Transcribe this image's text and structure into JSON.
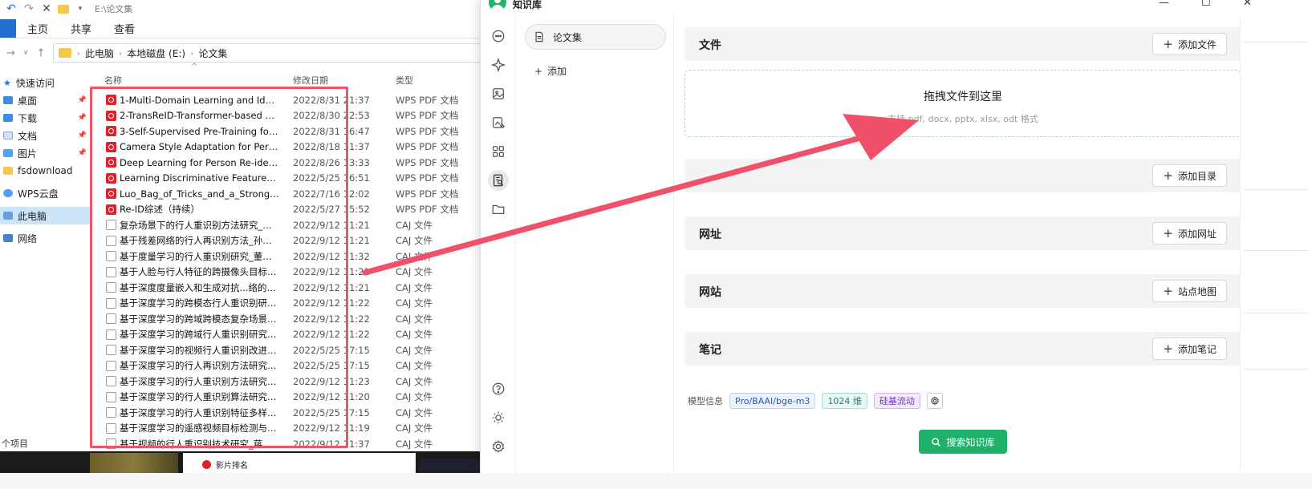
{
  "explorer": {
    "title_path": "E:\\论文集",
    "ribbon_tabs": [
      "主页",
      "共享",
      "查看"
    ],
    "breadcrumb": [
      "此电脑",
      "本地磁盘 (E:)",
      "论文集"
    ],
    "columns": {
      "name": "名称",
      "date": "修改日期",
      "type": "类型"
    },
    "nav": [
      {
        "label": "快速访问",
        "icon": "star-icon",
        "pinned": false,
        "selected": false
      },
      {
        "label": "桌面",
        "icon": "desktop-icon",
        "pinned": true,
        "selected": false
      },
      {
        "label": "下载",
        "icon": "download-icon",
        "pinned": true,
        "selected": false
      },
      {
        "label": "文档",
        "icon": "document-icon",
        "pinned": true,
        "selected": false
      },
      {
        "label": "图片",
        "icon": "picture-icon",
        "pinned": true,
        "selected": false
      },
      {
        "label": "fsdownload",
        "icon": "folder-icon",
        "pinned": false,
        "selected": false
      },
      {
        "label": "WPS云盘",
        "icon": "cloud-icon",
        "pinned": false,
        "selected": false
      },
      {
        "label": "此电脑",
        "icon": "computer-icon",
        "pinned": false,
        "selected": true
      },
      {
        "label": "网络",
        "icon": "network-icon",
        "pinned": false,
        "selected": false
      }
    ],
    "files": [
      {
        "name": "1-Multi-Domain Learning and Identit...",
        "date": "2022/8/31 21:37",
        "type": "WPS PDF 文档",
        "kind": "pdf"
      },
      {
        "name": "2-TransReID-Transformer-based Obj...",
        "date": "2022/8/30 22:53",
        "type": "WPS PDF 文档",
        "kind": "pdf"
      },
      {
        "name": "3-Self-Supervised Pre-Training for Tr...",
        "date": "2022/8/31 16:47",
        "type": "WPS PDF 文档",
        "kind": "pdf"
      },
      {
        "name": "Camera Style Adaptation for Person ...",
        "date": "2022/8/18 11:37",
        "type": "WPS PDF 文档",
        "kind": "pdf"
      },
      {
        "name": "Deep Learning for Person Re-identifi...",
        "date": "2022/8/26 13:33",
        "type": "WPS PDF 文档",
        "kind": "pdf"
      },
      {
        "name": "Learning Discriminative Features with...",
        "date": "2022/5/25 16:51",
        "type": "WPS PDF 文档",
        "kind": "pdf"
      },
      {
        "name": "Luo_Bag_of_Tricks_and_a_Strong_Bas...",
        "date": "2022/7/16 12:02",
        "type": "WPS PDF 文档",
        "kind": "pdf"
      },
      {
        "name": "Re-ID综述（持续）",
        "date": "2022/5/27 15:52",
        "type": "WPS PDF 文档",
        "kind": "pdf"
      },
      {
        "name": "复杂场景下的行人重识别方法研究_张正...",
        "date": "2022/9/12 11:21",
        "type": "CAJ 文件",
        "kind": "caj"
      },
      {
        "name": "基于残差网络的行人再识别方法_孙义博...",
        "date": "2022/9/12 11:21",
        "type": "CAJ 文件",
        "kind": "caj"
      },
      {
        "name": "基于度量学习的行人重识别研究_董亮胜...",
        "date": "2022/9/12 11:32",
        "type": "CAJ 文件",
        "kind": "caj"
      },
      {
        "name": "基于人脸与行人特征的跨摄像头目标识别...",
        "date": "2022/9/12 11:21",
        "type": "CAJ 文件",
        "kind": "caj"
      },
      {
        "name": "基于深度度量嵌入和生成对抗...络的遮挡...",
        "date": "2022/9/12 11:21",
        "type": "CAJ 文件",
        "kind": "caj"
      },
      {
        "name": "基于深度学习的跨模态行人重识别研究_...",
        "date": "2022/9/12 11:22",
        "type": "CAJ 文件",
        "kind": "caj"
      },
      {
        "name": "基于深度学习的跨域跨模态复杂场景下的...",
        "date": "2022/9/12 11:22",
        "type": "CAJ 文件",
        "kind": "caj"
      },
      {
        "name": "基于深度学习的跨域行人重识别研究_郝...",
        "date": "2022/9/12 11:22",
        "type": "CAJ 文件",
        "kind": "caj"
      },
      {
        "name": "基于深度学习的视频行人重识别改进与应...",
        "date": "2022/5/25 17:15",
        "type": "CAJ 文件",
        "kind": "caj"
      },
      {
        "name": "基于深度学习的行人再识别方法研究_王...",
        "date": "2022/5/25 17:15",
        "type": "CAJ 文件",
        "kind": "caj"
      },
      {
        "name": "基于深度学习的行人重识别方法研究_梁...",
        "date": "2022/9/12 11:23",
        "type": "CAJ 文件",
        "kind": "caj"
      },
      {
        "name": "基于深度学习的行人重识别算法研究_罗...",
        "date": "2022/9/12 11:20",
        "type": "CAJ 文件",
        "kind": "caj"
      },
      {
        "name": "基于深度学习的行人重识别特征多样性研...",
        "date": "2022/5/25 17:15",
        "type": "CAJ 文件",
        "kind": "caj"
      },
      {
        "name": "基于深度学习的遥感视频目标检测与多目...",
        "date": "2022/9/12 11:19",
        "type": "CAJ 文件",
        "kind": "caj"
      },
      {
        "name": "基于视频的行人重识别技术研究_蒋飞虎...",
        "date": "2022/9/12 11:37",
        "type": "CAJ 文件",
        "kind": "caj"
      }
    ],
    "status_count": "个项目",
    "taskbar_rank": "影片排名"
  },
  "app": {
    "name": "知识库",
    "kb_item": "论文集",
    "kb_add": "添加",
    "sections": {
      "files": {
        "title": "文件",
        "button": "添加文件"
      },
      "directory": {
        "title": "",
        "button": "添加目录"
      },
      "url": {
        "title": "网址",
        "button": "添加网址"
      },
      "site": {
        "title": "网站",
        "button": "站点地图"
      },
      "note": {
        "title": "笔记",
        "button": "添加笔记"
      }
    },
    "dropzone": {
      "title": "拖拽文件到这里",
      "subtitle": "支持 pdf, docx, pptx, xlsx, odt 格式"
    },
    "model_info": {
      "label": "模型信息",
      "model": "Pro/BAAI/bge-m3",
      "dims": "1024 维",
      "provider": "硅基流动"
    },
    "search_button": "搜索知识库",
    "colors": {
      "accent": "#1fb06a",
      "annotation": "#ee5566"
    }
  }
}
